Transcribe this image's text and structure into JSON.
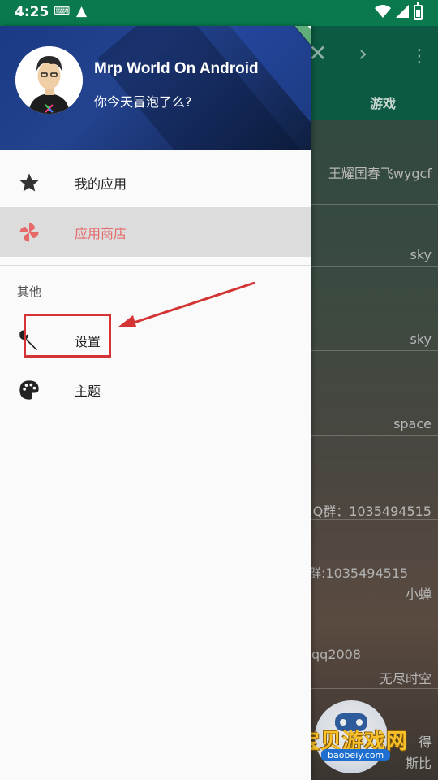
{
  "status_bar": {
    "time": "4:25"
  },
  "drawer": {
    "header": {
      "title": "Mrp World On Android",
      "subtitle": "你今天冒泡了么?"
    },
    "menu": [
      {
        "label": "我的应用",
        "icon": "star-icon"
      },
      {
        "label": "应用商店",
        "icon": "pinwheel-icon",
        "selected": true
      },
      {
        "label": "设置",
        "icon": "wrench-icon"
      },
      {
        "label": "主题",
        "icon": "palette-icon"
      }
    ],
    "section_label": "其他"
  },
  "background_app": {
    "tab": "游戏",
    "rows": [
      "王耀国春飞wygcf",
      "sky",
      "sky",
      "space",
      "Q群：1035494515",
      "群:1035494515",
      "小蝉",
      "qq2008",
      "无尽时空",
      "得",
      "斯比"
    ]
  },
  "watermark": {
    "text": "宝贝游戏网",
    "url": "baobeiy.com"
  },
  "colors": {
    "accent": "#e66a6a",
    "status_bar": "#0a7a4e",
    "annotation": "#d43434"
  }
}
